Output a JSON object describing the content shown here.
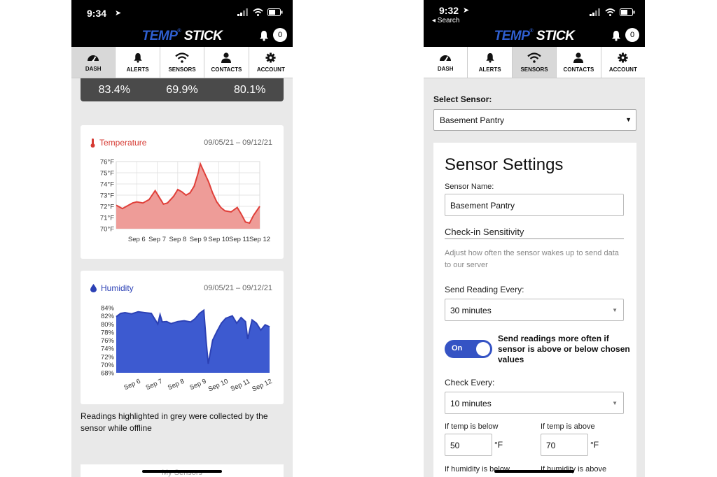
{
  "left_phone": {
    "status": {
      "time": "9:34"
    },
    "header": {
      "logo_a": "TEMP",
      "logo_b": "STICK",
      "notification_count": "0"
    },
    "tabs": [
      {
        "label": "DASH",
        "icon": "gauge-icon",
        "active": true
      },
      {
        "label": "ALERTS",
        "icon": "bell-icon",
        "active": false
      },
      {
        "label": "SENSORS",
        "icon": "wifi-icon",
        "active": false
      },
      {
        "label": "CONTACTS",
        "icon": "person-icon",
        "active": false
      },
      {
        "label": "ACCOUNT",
        "icon": "gear-icon",
        "active": false
      }
    ],
    "humidity_strip": [
      "83.4%",
      "69.9%",
      "80.1%"
    ],
    "temperature_card": {
      "title": "Temperature",
      "range": "09/05/21 – 09/12/21"
    },
    "humidity_card": {
      "title": "Humidity",
      "range": "09/05/21 – 09/12/21"
    },
    "note": "Readings highlighted in grey were collected by the sensor while offline",
    "my_sensors": "My Sensors"
  },
  "right_phone": {
    "status": {
      "time": "9:32",
      "back": "◂ Search"
    },
    "header": {
      "logo_a": "TEMP",
      "logo_b": "STICK",
      "notification_count": "0"
    },
    "tabs": [
      {
        "label": "DASH",
        "icon": "gauge-icon",
        "active": false
      },
      {
        "label": "ALERTS",
        "icon": "bell-icon",
        "active": false
      },
      {
        "label": "SENSORS",
        "icon": "wifi-icon",
        "active": true
      },
      {
        "label": "CONTACTS",
        "icon": "person-icon",
        "active": false
      },
      {
        "label": "ACCOUNT",
        "icon": "gear-icon",
        "active": false
      }
    ],
    "select_sensor_label": "Select Sensor:",
    "select_sensor_value": "Basement Pantry",
    "settings": {
      "title": "Sensor Settings",
      "name_label": "Sensor Name:",
      "name_value": "Basement Pantry",
      "checkin_heading": "Check-in Sensitivity",
      "checkin_desc": "Adjust how often the sensor wakes up to send data to our server",
      "send_label": "Send Reading Every:",
      "send_value": "30 minutes",
      "toggle_text": "On",
      "toggle_desc": "Send readings more often if sensor is above or below chosen values",
      "check_label": "Check Every:",
      "check_value": "10 minutes",
      "temp_below_label": "If temp is below",
      "temp_below_value": "50",
      "temp_below_unit": "°F",
      "temp_above_label": "If temp is above",
      "temp_above_value": "70",
      "temp_above_unit": "°F",
      "hum_below_label": "If humidity is below",
      "hum_above_label": "If humidity is above"
    }
  },
  "colors": {
    "temp": "#e0403a",
    "temp_fill": "#ee9c98",
    "hum": "#2c41b5",
    "hum_fill": "#3d5ad0",
    "accent": "#3553c4"
  },
  "chart_data": [
    {
      "type": "area",
      "title": "Temperature",
      "x_ticks": [
        "Sep 6",
        "Sep 7",
        "Sep 8",
        "Sep 9",
        "Sep 10",
        "Sep 11",
        "Sep 12"
      ],
      "y_ticks": [
        "70°F",
        "71°F",
        "72°F",
        "73°F",
        "74°F",
        "75°F",
        "76°F"
      ],
      "ylim": [
        70,
        76
      ],
      "xlim": [
        5,
        12
      ],
      "x": [
        5.0,
        5.3,
        5.6,
        5.8,
        6.0,
        6.3,
        6.6,
        6.9,
        7.1,
        7.3,
        7.5,
        7.8,
        8.0,
        8.2,
        8.4,
        8.6,
        8.8,
        9.0,
        9.1,
        9.3,
        9.5,
        9.7,
        9.9,
        10.1,
        10.3,
        10.6,
        10.9,
        11.1,
        11.3,
        11.5,
        11.7,
        12.0
      ],
      "values": [
        72.1,
        71.8,
        72.1,
        72.3,
        72.4,
        72.3,
        72.6,
        73.4,
        72.8,
        72.2,
        72.3,
        72.9,
        73.5,
        73.3,
        73.0,
        73.2,
        73.8,
        75.0,
        75.8,
        75.0,
        74.2,
        73.2,
        72.4,
        71.9,
        71.6,
        71.5,
        71.9,
        71.3,
        70.6,
        70.5,
        71.2,
        72.0
      ]
    },
    {
      "type": "area",
      "title": "Humidity",
      "x_ticks": [
        "Sep 6",
        "Sep 7",
        "Sep 8",
        "Sep 9",
        "Sep 10",
        "Sep 11",
        "Sep 12"
      ],
      "y_ticks": [
        "68%",
        "70%",
        "72%",
        "74%",
        "76%",
        "78%",
        "80%",
        "82%",
        "84%"
      ],
      "ylim": [
        68,
        84
      ],
      "xlim": [
        5,
        12
      ],
      "x": [
        5.0,
        5.2,
        5.4,
        5.7,
        6.0,
        6.3,
        6.6,
        6.9,
        7.0,
        7.1,
        7.3,
        7.5,
        7.8,
        8.1,
        8.4,
        8.6,
        8.8,
        9.0,
        9.1,
        9.2,
        9.4,
        9.6,
        9.8,
        10.0,
        10.3,
        10.5,
        10.7,
        10.9,
        11.0,
        11.2,
        11.4,
        11.6,
        11.8,
        12.0
      ],
      "values": [
        81.8,
        82.6,
        82.8,
        82.5,
        83.0,
        82.8,
        82.6,
        80.0,
        82.3,
        80.5,
        80.6,
        80.1,
        80.6,
        80.8,
        80.5,
        81.3,
        82.6,
        83.4,
        76.0,
        70.2,
        76.0,
        78.2,
        80.2,
        81.4,
        82.0,
        80.2,
        81.6,
        80.6,
        76.3,
        81.0,
        80.2,
        78.5,
        79.8,
        79.3
      ]
    }
  ]
}
